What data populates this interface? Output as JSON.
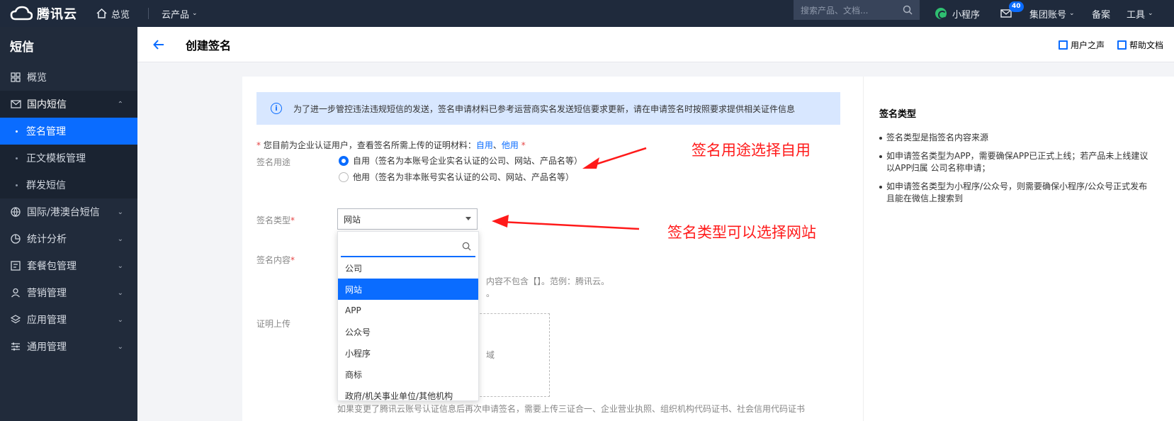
{
  "topbar": {
    "brand": "腾讯云",
    "home": "总览",
    "products": "云产品",
    "search_placeholder": "搜索产品、文档...",
    "mini_program": "小程序",
    "mail_badge": "40",
    "group_account": "集团账号",
    "beian": "备案",
    "tools": "工具"
  },
  "sidebar": {
    "title": "短信",
    "items": [
      {
        "label": "概览"
      },
      {
        "label": "国内短信"
      },
      {
        "label": "国际/港澳台短信"
      },
      {
        "label": "统计分析"
      },
      {
        "label": "套餐包管理"
      },
      {
        "label": "营销管理"
      },
      {
        "label": "应用管理"
      },
      {
        "label": "通用管理"
      }
    ],
    "sub_items": [
      {
        "label": "签名管理"
      },
      {
        "label": "正文模板管理"
      },
      {
        "label": "群发短信"
      }
    ]
  },
  "header": {
    "title": "创建签名",
    "voice": "用户之声",
    "help": "帮助文档"
  },
  "form": {
    "notice": "为了进一步管控违法违规短信的发送，签名申请材料已参考运营商实名发送短信要求更新，请在申请签名时按照要求提供相关证件信息",
    "req_prefix": "* ",
    "req_text": "您目前为企业认证用户，查看签名所需上传的证明材料：",
    "req_link1": "自用",
    "req_sep": "、",
    "req_link2": "他用",
    "req_suffix": " *",
    "purpose_label": "签名用途",
    "purpose_opt1": "自用（签名为本账号企业实名认证的公司、网站、产品名等）",
    "purpose_opt2": "他用（签名为非本账号实名认证的公司、网站、产品名等）",
    "type_label": "签名类型",
    "type_value": "网站",
    "content_label": "签名内容",
    "content_hint1": "内容不包含【】。范例：腾讯云。",
    "content_hint2": "。",
    "upload_label": "证明上传",
    "upload_hint": "域",
    "bottom_text": "如果变更了腾讯云账号认证信息后再次申请签名，需要上传三证合一、企业营业执照、组织机构代码证书、社会信用代码证书"
  },
  "dropdown": {
    "options": [
      "公司",
      "网站",
      "APP",
      "公众号",
      "小程序",
      "商标",
      "政府/机关事业单位/其他机构"
    ],
    "selected": "网站"
  },
  "info": {
    "title": "签名类型",
    "items": [
      "签名类型是指签名内容来源",
      "如申请签名类型为APP，需要确保APP已正式上线；若产品未上线建议以APP归属 公司名称申请；",
      "如申请签名类型为小程序/公众号，则需要确保小程序/公众号正式发布且能在微信上搜索到"
    ]
  },
  "annotations": {
    "note1": "签名用途选择自用",
    "note2": "签名类型可以选择网站",
    "color": "#ff1a1a"
  },
  "colors": {
    "accent": "#0a6cff",
    "topbar": "#1f2a3c",
    "sidebar": "#212b3b"
  }
}
